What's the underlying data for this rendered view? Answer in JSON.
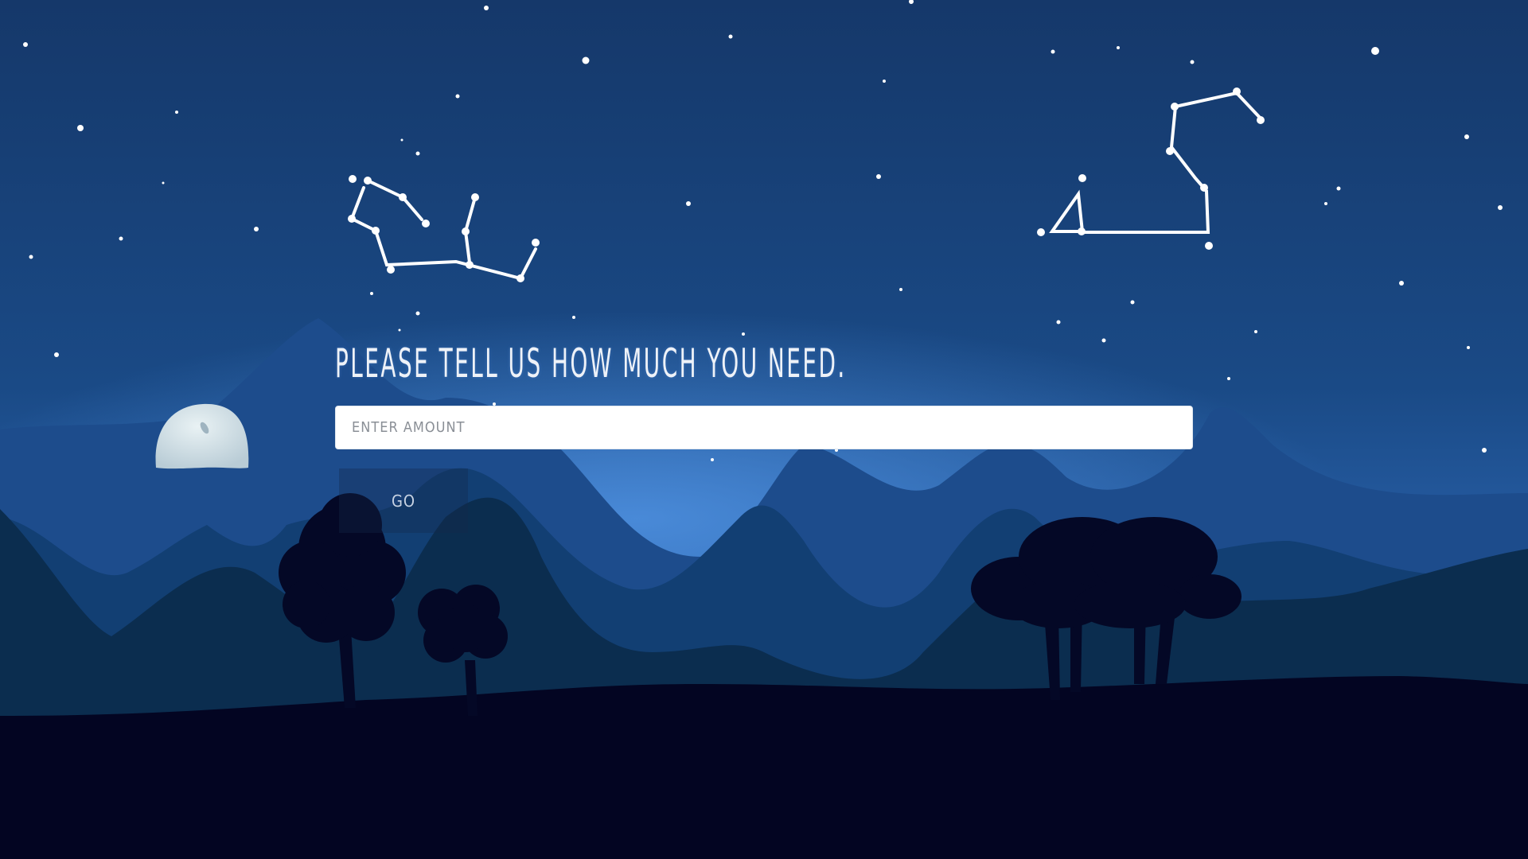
{
  "headline": "PLEASE TELL US HOW MUCH YOU NEED.",
  "amount_input": {
    "placeholder": "ENTER AMOUNT",
    "value": ""
  },
  "go_button": "GO",
  "colors": {
    "sky_top": "#15386a",
    "sky_glow": "#3f7fd0",
    "far_mountains": "#1d4c8c",
    "mid_mountains": "#123f73",
    "near_hills": "#0b2d4f",
    "ground": "#030522"
  }
}
